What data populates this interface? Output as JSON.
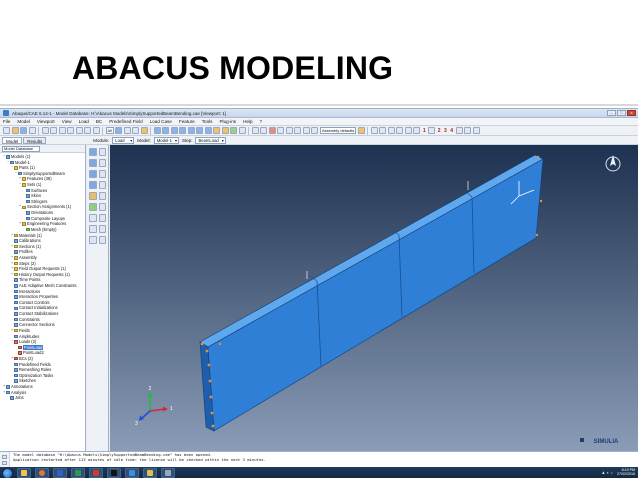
{
  "slide": {
    "title": "ABACUS MODELING"
  },
  "window": {
    "title": "Abaqus/CAE 6.14-1 - Model Database: H:\\Abacus Models\\SimplySupportedBeamBending.cae [Viewport: 1]",
    "controls": [
      "–",
      "□",
      "x"
    ]
  },
  "menu": [
    "File",
    "Model",
    "Viewport",
    "View",
    "Load",
    "BC",
    "Predefined Field",
    "Load Case",
    "Feature",
    "Tools",
    "Plug-ins",
    "Help",
    "?"
  ],
  "toolbar": {
    "render_select": "All",
    "assembly_select": "Assembly defaults",
    "numbers": [
      "1",
      "2",
      "3",
      "4"
    ]
  },
  "tabs": [
    "Model",
    "Results"
  ],
  "context": {
    "module_label": "Module:",
    "module_value": "Load",
    "model_label": "Model:",
    "model_value": "Model-1",
    "step_label": "Step:",
    "step_value": "BeamLoad"
  },
  "tree": {
    "header": "Model Database",
    "items": [
      {
        "depth": 0,
        "exp": "−",
        "icon": "b",
        "label": "Models (1)"
      },
      {
        "depth": 1,
        "exp": "−",
        "icon": "b",
        "label": "Model-1"
      },
      {
        "depth": 2,
        "exp": "−",
        "icon": "y",
        "label": "Parts (1)"
      },
      {
        "depth": 3,
        "exp": "−",
        "icon": "b",
        "label": "SimplySupportedBeam"
      },
      {
        "depth": 4,
        "exp": "+",
        "icon": "y",
        "label": "Features (38)"
      },
      {
        "depth": 4,
        "exp": "−",
        "icon": "y",
        "label": "Sets (1)"
      },
      {
        "depth": 5,
        "exp": "",
        "icon": "b",
        "label": "Surfaces"
      },
      {
        "depth": 5,
        "exp": "",
        "icon": "b",
        "label": "Skins"
      },
      {
        "depth": 5,
        "exp": "",
        "icon": "b",
        "label": "Stringers"
      },
      {
        "depth": 4,
        "exp": "+",
        "icon": "y",
        "label": "Section Assignments (1)"
      },
      {
        "depth": 5,
        "exp": "",
        "icon": "b",
        "label": "Orientations"
      },
      {
        "depth": 5,
        "exp": "",
        "icon": "b",
        "label": "Composite Layups"
      },
      {
        "depth": 4,
        "exp": "+",
        "icon": "y",
        "label": "Engineering Features"
      },
      {
        "depth": 5,
        "exp": "",
        "icon": "g",
        "label": "Mesh (Empty)"
      },
      {
        "depth": 2,
        "exp": "+",
        "icon": "y",
        "label": "Materials (1)"
      },
      {
        "depth": 2,
        "exp": "",
        "icon": "b",
        "label": "Calibrations"
      },
      {
        "depth": 2,
        "exp": "+",
        "icon": "y",
        "label": "Sections (1)"
      },
      {
        "depth": 2,
        "exp": "",
        "icon": "b",
        "label": "Profiles"
      },
      {
        "depth": 2,
        "exp": "+",
        "icon": "y",
        "label": "Assembly"
      },
      {
        "depth": 2,
        "exp": "+",
        "icon": "y",
        "label": "Steps (2)"
      },
      {
        "depth": 2,
        "exp": "+",
        "icon": "y",
        "label": "Field Output Requests (1)"
      },
      {
        "depth": 2,
        "exp": "+",
        "icon": "y",
        "label": "History Output Requests (1)"
      },
      {
        "depth": 2,
        "exp": "",
        "icon": "b",
        "label": "Time Points"
      },
      {
        "depth": 2,
        "exp": "",
        "icon": "b",
        "label": "ALE Adaptive Mesh Constraints"
      },
      {
        "depth": 2,
        "exp": "",
        "icon": "b",
        "label": "Interactions"
      },
      {
        "depth": 2,
        "exp": "",
        "icon": "b",
        "label": "Interaction Properties"
      },
      {
        "depth": 2,
        "exp": "",
        "icon": "b",
        "label": "Contact Controls"
      },
      {
        "depth": 2,
        "exp": "",
        "icon": "b",
        "label": "Contact Initializations"
      },
      {
        "depth": 2,
        "exp": "",
        "icon": "b",
        "label": "Contact Stabilizations"
      },
      {
        "depth": 2,
        "exp": "",
        "icon": "b",
        "label": "Constraints"
      },
      {
        "depth": 2,
        "exp": "",
        "icon": "b",
        "label": "Connector Sections"
      },
      {
        "depth": 2,
        "exp": "+",
        "icon": "y",
        "label": "Fields"
      },
      {
        "depth": 2,
        "exp": "",
        "icon": "b",
        "label": "Amplitudes"
      },
      {
        "depth": 2,
        "exp": "−",
        "icon": "r",
        "label": "Loads (2)"
      },
      {
        "depth": 3,
        "exp": "",
        "icon": "r",
        "label": "PointLoad",
        "selected": true
      },
      {
        "depth": 3,
        "exp": "",
        "icon": "r",
        "label": "PointLoad2"
      },
      {
        "depth": 2,
        "exp": "+",
        "icon": "r",
        "label": "BCs (2)"
      },
      {
        "depth": 2,
        "exp": "",
        "icon": "b",
        "label": "Predefined Fields"
      },
      {
        "depth": 2,
        "exp": "",
        "icon": "b",
        "label": "Remeshing Rules"
      },
      {
        "depth": 2,
        "exp": "",
        "icon": "b",
        "label": "Optimization Tasks"
      },
      {
        "depth": 2,
        "exp": "",
        "icon": "b",
        "label": "Sketches"
      },
      {
        "depth": 0,
        "exp": "+",
        "icon": "b",
        "label": "Annotations"
      },
      {
        "depth": 0,
        "exp": "+",
        "icon": "b",
        "label": "Analysis"
      },
      {
        "depth": 1,
        "exp": "",
        "icon": "b",
        "label": "Jobs"
      }
    ]
  },
  "viewport": {
    "background_top": "#1d3150",
    "background_bottom": "#8a9cb6",
    "beam_front": "#2f7fd6",
    "beam_top": "#5fa8ee",
    "beam_end": "#1d5fae",
    "brand": "SIMULIA",
    "axes": [
      "1",
      "2",
      "3"
    ]
  },
  "messages": [
    "The model database \"H:\\Abacus Models\\SimplySupportedBeamBending.cae\" has been opened.",
    "Application restarted after 113 minutes of idle time: the license will be checked within the next 3 minutes."
  ],
  "taskbar": {
    "apps": [
      "explorer",
      "firefox",
      "word",
      "excel",
      "pdf",
      "terminal",
      "abaqus",
      "paint",
      "settings"
    ],
    "clock_time": "8:19 PM",
    "clock_date": "27/02/2016"
  }
}
